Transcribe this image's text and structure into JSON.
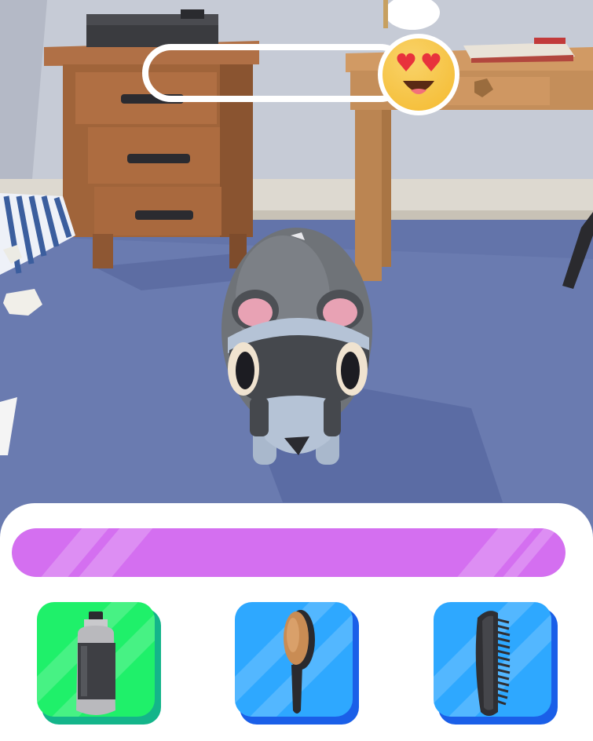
{
  "mood": {
    "level": 0.95,
    "emoji": "heart-eyes-emoji"
  },
  "progress": {
    "level": 1.0,
    "color": "#d46ff0"
  },
  "tools": [
    {
      "name": "shampoo-bottle",
      "icon": "shampoo-bottle-icon",
      "color": "#1ff06a",
      "shadow": "#14b58a",
      "selected": true
    },
    {
      "name": "hair-brush",
      "icon": "hair-brush-icon",
      "color": "#2ea8ff",
      "shadow": "#1a5fe8",
      "selected": false
    },
    {
      "name": "comb",
      "icon": "comb-icon",
      "color": "#2ea8ff",
      "shadow": "#1a5fe8",
      "selected": false
    }
  ],
  "colors": {
    "floor": "#6a7bb0",
    "wall": "#c9cdd6",
    "furniture": "#a0643a",
    "desk": "#c48e5a",
    "pet_body": "#6f7378",
    "pet_mask": "#4a4d52",
    "pet_ears": "#e8a2b4"
  }
}
